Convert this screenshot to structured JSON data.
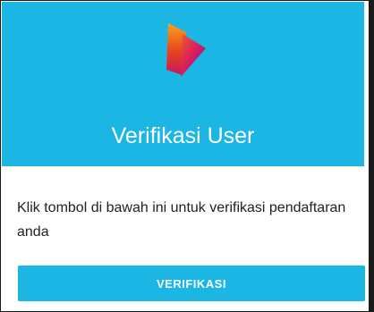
{
  "header": {
    "title": "Verifikasi User",
    "background_color": "#1bb6e3",
    "logo_icon": "play-logo-icon"
  },
  "message": {
    "text": "Klik tombol di bawah ini untuk verifikasi pendaftaran anda"
  },
  "actions": {
    "verify_label": "VERIFIKASI",
    "button_color": "#1bb6e3"
  }
}
